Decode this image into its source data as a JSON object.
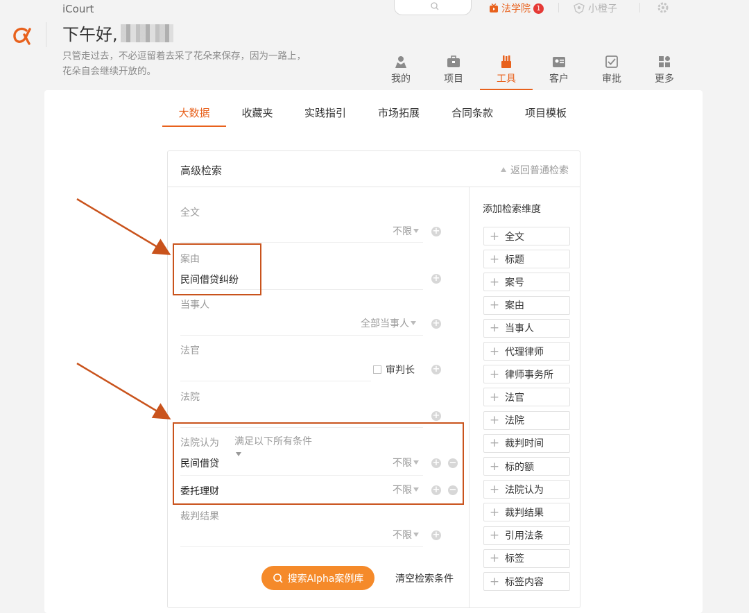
{
  "app": {
    "name": "iCourt"
  },
  "header": {
    "greeting": "下午好,",
    "motto": "只管走过去，不必逗留着去采了花朵来保存，因为一路上，花朵自会继续开放的。",
    "fxy_label": "法学院",
    "fxy_badge": "1",
    "user_name": "小橙子"
  },
  "nav": [
    {
      "label": "我的",
      "icon": "person-icon"
    },
    {
      "label": "项目",
      "icon": "briefcase-icon"
    },
    {
      "label": "工具",
      "icon": "tools-icon",
      "active": true
    },
    {
      "label": "客户",
      "icon": "contact-card-icon"
    },
    {
      "label": "审批",
      "icon": "approval-icon"
    },
    {
      "label": "更多",
      "icon": "grid-icon"
    }
  ],
  "tabs": [
    "大数据",
    "收藏夹",
    "实践指引",
    "市场拓展",
    "合同条款",
    "项目模板"
  ],
  "advanced_search": {
    "title": "高级检索",
    "back_link": "返回普通检索",
    "fields": {
      "fulltext": {
        "label": "全文",
        "option": "不限"
      },
      "case_cause": {
        "label": "案由",
        "value": "民间借贷纠纷"
      },
      "party": {
        "label": "当事人",
        "option": "全部当事人"
      },
      "judge": {
        "label": "法官",
        "checkbox": "审判长"
      },
      "court": {
        "label": "法院"
      },
      "court_holds": {
        "label": "法院认为",
        "condition": "满足以下所有条件",
        "rows": [
          {
            "value": "民间借贷",
            "option": "不限"
          },
          {
            "value": "委托理财",
            "option": "不限"
          }
        ]
      },
      "result": {
        "label": "裁判结果",
        "option": "不限"
      }
    },
    "search_button": "搜索Alpha案例库",
    "clear_link": "清空检索条件",
    "dimensions_title": "添加检索维度",
    "dimensions": [
      "全文",
      "标题",
      "案号",
      "案由",
      "当事人",
      "代理律师",
      "律师事务所",
      "法官",
      "法院",
      "裁判时间",
      "标的额",
      "法院认为",
      "裁判结果",
      "引用法条",
      "标签",
      "标签内容"
    ]
  },
  "colors": {
    "accent": "#e8611c",
    "button": "#f58a2a",
    "annotation": "#c9531c"
  }
}
